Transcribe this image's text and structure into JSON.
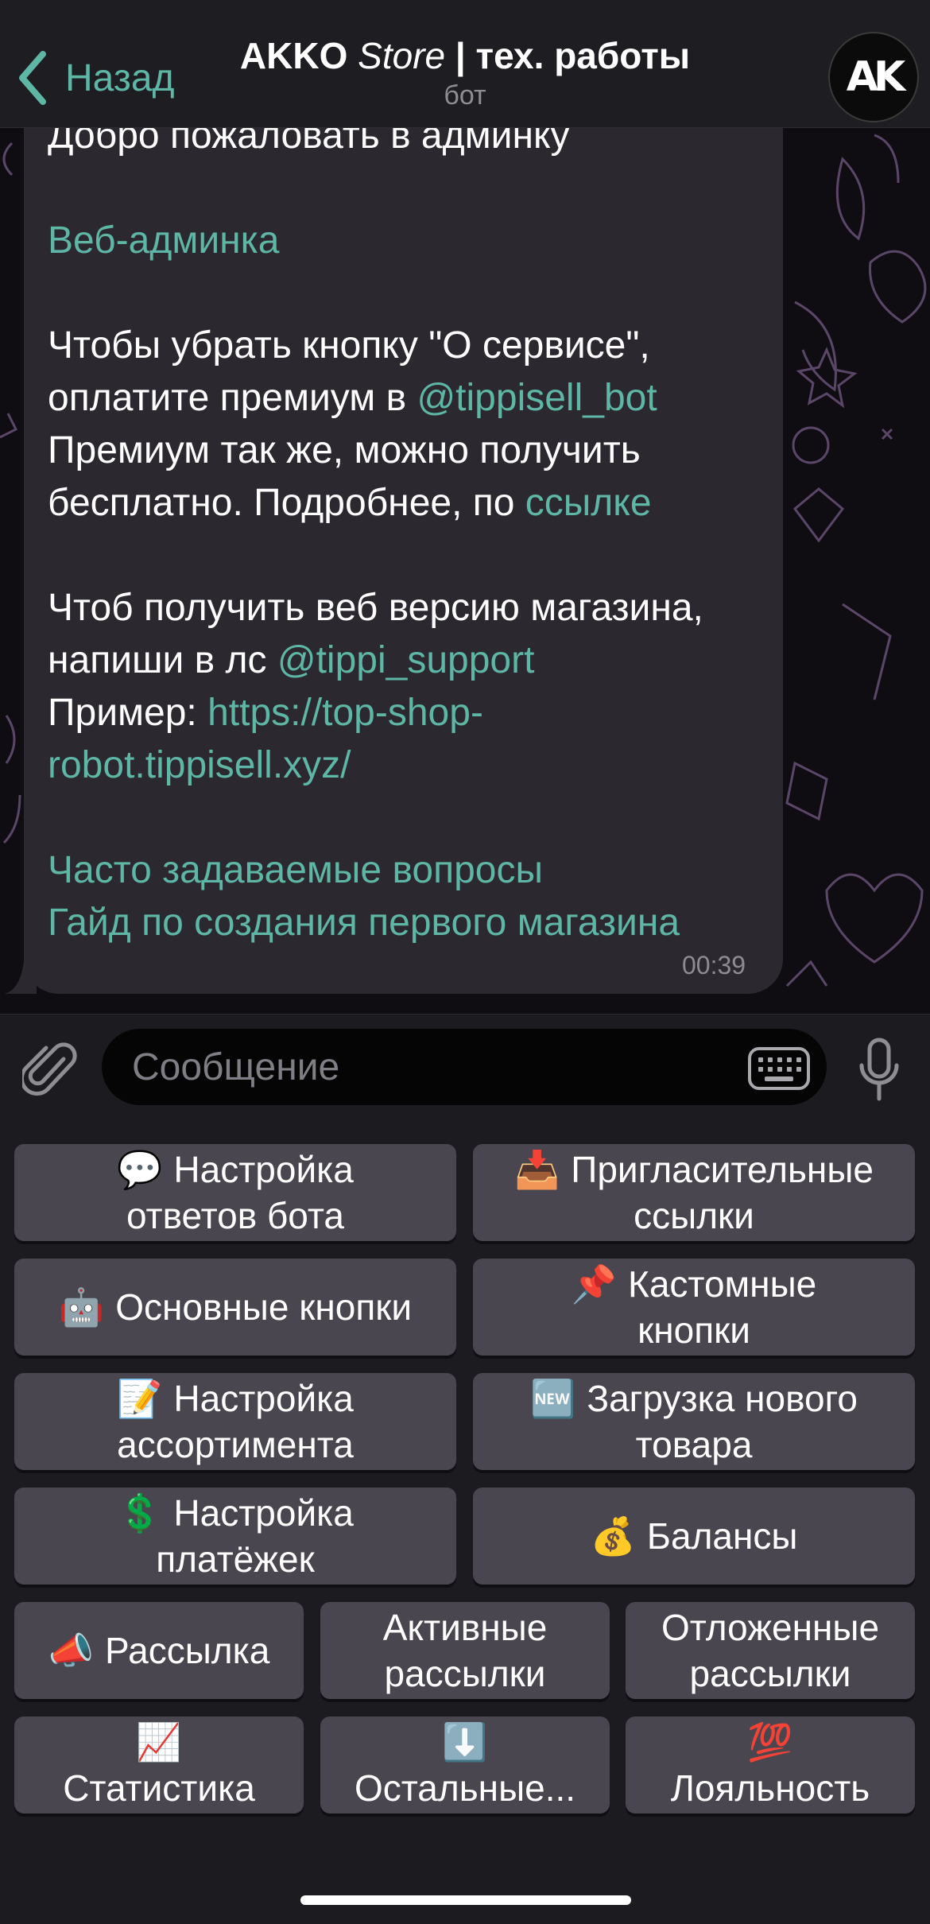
{
  "header": {
    "back_label": "Назад",
    "title_brand": "AKKO",
    "title_store": "Store",
    "title_rest": "| тех. работы",
    "subtitle": "бот",
    "avatar_text": "AK"
  },
  "message": {
    "line_welcome": "Добро пожаловать в админку",
    "web_admin_link": "Веб-админка",
    "premium_line1": "Чтобы убрать кнопку \"О сервисе\",",
    "premium_line2_text": "оплатите премиум в",
    "premium_bot_link": "@tippisell_bot",
    "premium_line3": "Премиум так же, можно получить",
    "premium_line4_text": "бесплатно. Подробнее, по",
    "premium_link": "ссылке",
    "web_line1": "Чтоб получить веб версию магазина,",
    "web_line2_text": "напиши в лс",
    "support_link": "@tippi_support",
    "example_label": "Пример:",
    "example_link_part1": "https://top-shop-",
    "example_link_part2": "robot.tippisell.xyz/",
    "faq_link": "Часто задаваемые вопросы",
    "guide_link": "Гайд по создания первого магазина",
    "time": "00:39"
  },
  "input": {
    "placeholder": "Сообщение"
  },
  "keyboard": {
    "bot_replies": {
      "emoji": "💬",
      "line1": "Настройка",
      "line2": "ответов бота"
    },
    "invite_links": {
      "emoji": "📥",
      "line1": "Пригласительные",
      "line2": "ссылки"
    },
    "main_buttons": {
      "emoji": "🤖",
      "label": "Основные кнопки"
    },
    "custom_buttons": {
      "emoji": "📌",
      "line1": "Кастомные",
      "line2": "кнопки"
    },
    "assortment": {
      "emoji": "📝",
      "line1": "Настройка",
      "line2": "ассортимента"
    },
    "new_product": {
      "emoji": "🆕",
      "line1": "Загрузка нового",
      "line2": "товара"
    },
    "payments": {
      "emoji": "💲",
      "line1": "Настройка",
      "line2": "платёжек"
    },
    "balances": {
      "emoji": "💰",
      "label": "Балансы"
    },
    "mailing": {
      "emoji": "📣",
      "label": "Рассылка"
    },
    "active_mailings": {
      "line1": "Активные",
      "line2": "рассылки"
    },
    "delayed_mailings": {
      "line1": "Отложенные",
      "line2": "рассылки"
    },
    "statistics": {
      "emoji": "📈",
      "label": "Статистика"
    },
    "others": {
      "emoji": "⬇️",
      "label": "Остальные..."
    },
    "loyalty": {
      "emoji": "💯",
      "label": "Лояльность"
    }
  },
  "colors": {
    "accent": "#5eb6a5",
    "bubble": "#2b2830",
    "key": "#49464f"
  }
}
